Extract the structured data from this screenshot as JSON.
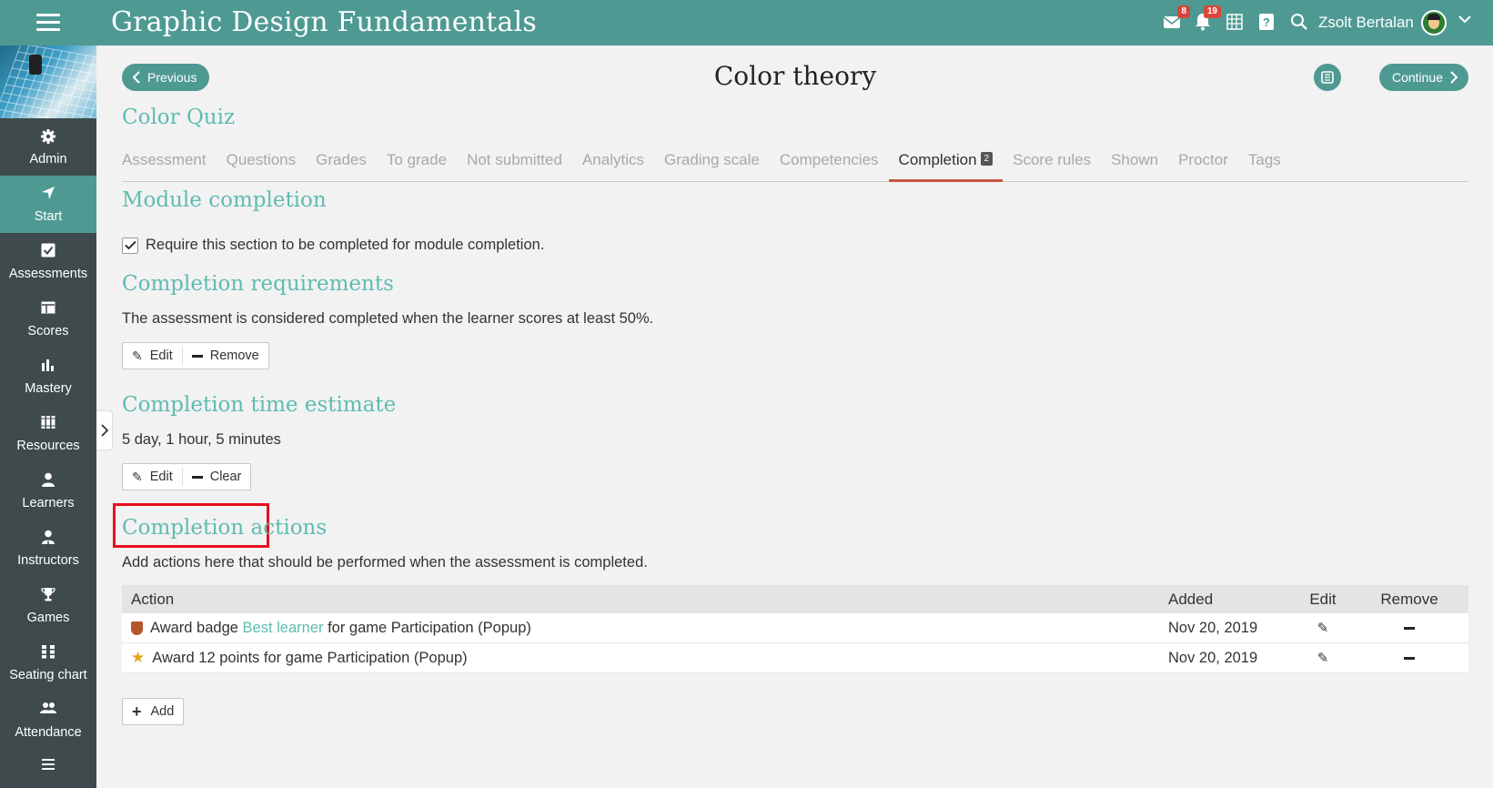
{
  "topbar": {
    "app_title": "Graphic Design Fundamentals",
    "messages_badge": "8",
    "notifications_badge": "19",
    "user_name": "Zsolt Bertalan"
  },
  "sidebar": {
    "items": [
      {
        "label": "Admin",
        "icon": "gear-icon"
      },
      {
        "label": "Start",
        "icon": "location-arrow-icon",
        "active": true
      },
      {
        "label": "Assessments",
        "icon": "checkbox-icon"
      },
      {
        "label": "Scores",
        "icon": "scores-table-icon"
      },
      {
        "label": "Mastery",
        "icon": "bar-chart-icon"
      },
      {
        "label": "Resources",
        "icon": "books-icon"
      },
      {
        "label": "Learners",
        "icon": "person-icon"
      },
      {
        "label": "Instructors",
        "icon": "instructor-icon"
      },
      {
        "label": "Games",
        "icon": "trophy-icon"
      },
      {
        "label": "Seating chart",
        "icon": "seating-icon"
      },
      {
        "label": "Attendance",
        "icon": "people-icon"
      }
    ]
  },
  "header": {
    "previous_label": "Previous",
    "page_title": "Color theory",
    "continue_label": "Continue"
  },
  "quiz_title": "Color Quiz",
  "tabs": [
    {
      "label": "Assessment"
    },
    {
      "label": "Questions"
    },
    {
      "label": "Grades"
    },
    {
      "label": "To grade"
    },
    {
      "label": "Not submitted"
    },
    {
      "label": "Analytics"
    },
    {
      "label": "Grading scale"
    },
    {
      "label": "Competencies"
    },
    {
      "label": "Completion",
      "count": "2",
      "active": true
    },
    {
      "label": "Score rules"
    },
    {
      "label": "Shown"
    },
    {
      "label": "Proctor"
    },
    {
      "label": "Tags"
    }
  ],
  "module_completion": {
    "title": "Module completion",
    "checkbox_label": "Require this section to be completed for module completion.",
    "checked": true
  },
  "completion_requirements": {
    "title": "Completion requirements",
    "text": "The assessment is considered completed when the learner scores at least 50%.",
    "edit_label": "Edit",
    "remove_label": "Remove"
  },
  "time_estimate": {
    "title": "Completion time estimate",
    "text": "5 day, 1 hour, 5 minutes",
    "edit_label": "Edit",
    "clear_label": "Clear"
  },
  "completion_actions": {
    "title": "Completion actions",
    "text": "Add actions here that should be performed when the assessment is completed.",
    "columns": {
      "action": "Action",
      "added": "Added",
      "edit": "Edit",
      "remove": "Remove"
    },
    "rows": [
      {
        "icon": "badge-shield-icon",
        "prefix": "Award badge ",
        "link": "Best learner",
        "suffix": " for game Participation (Popup)",
        "added": "Nov 20, 2019"
      },
      {
        "icon": "star-icon",
        "prefix": "Award 12 points for game Participation (Popup)",
        "link": "",
        "suffix": "",
        "added": "Nov 20, 2019"
      }
    ],
    "add_label": "Add"
  },
  "colors": {
    "brand": "#4e9a93",
    "heading": "#5fbcb0",
    "sidebar": "#3e4a4c",
    "badge": "#d9453c",
    "active_tab_underline": "#c9543f",
    "highlight": "#e8101e"
  }
}
